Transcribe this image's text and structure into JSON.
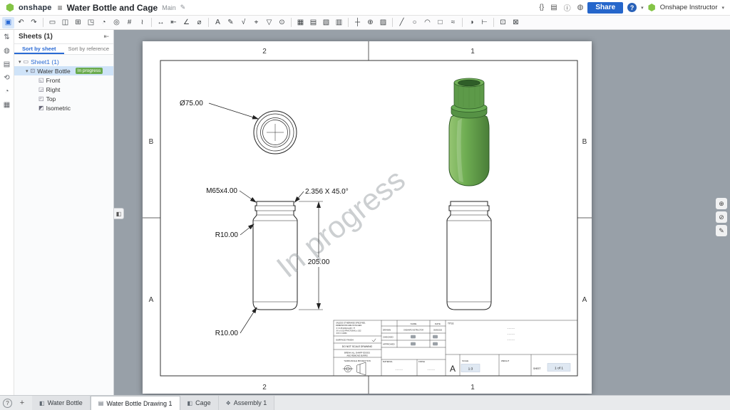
{
  "colors": {
    "accent_blue": "#2a6ad4",
    "share_blue": "#2566cb",
    "badge_green": "#6aab4e",
    "bottle_green": "#6fae53",
    "canvas_gray": "#98a0a8"
  },
  "header": {
    "logo_text": "onshape",
    "menu_icon": "≡",
    "title": "Water Bottle and Cage",
    "branch": "Main",
    "doc_icon": "✎",
    "right_icons": [
      {
        "n": "featurescript-icon",
        "g": "{}"
      },
      {
        "n": "spreadsheet-icon",
        "g": "▤"
      },
      {
        "n": "info-icon",
        "g": "ⓘ"
      },
      {
        "n": "app-store-icon",
        "g": "◍"
      }
    ],
    "share_label": "Share",
    "help_label": "?",
    "caret": "▾",
    "user_name": "Onshape Instructor"
  },
  "toolbar": {
    "items": [
      {
        "n": "select-tool-icon",
        "g": "▣",
        "act": true
      },
      {
        "n": "undo-icon",
        "g": "↶"
      },
      {
        "n": "redo-icon",
        "g": "↷"
      },
      {
        "sep": true,
        "n": "divider"
      },
      {
        "n": "insert-sheet-icon",
        "g": "▭"
      },
      {
        "n": "sheet-properties-icon",
        "g": "◫"
      },
      {
        "n": "insert-view-icon",
        "g": "⊞"
      },
      {
        "n": "projected-view-icon",
        "g": "◳"
      },
      {
        "n": "section-view-icon",
        "g": "◔"
      },
      {
        "n": "detail-view-icon",
        "g": "◎"
      },
      {
        "n": "crop-view-icon",
        "g": "#"
      },
      {
        "n": "break-view-icon",
        "g": "≀"
      },
      {
        "sep": true,
        "n": "divider"
      },
      {
        "n": "dimension-icon",
        "g": "↔"
      },
      {
        "n": "ordinate-dimension-icon",
        "g": "⇤"
      },
      {
        "n": "angle-dimension-icon",
        "g": "∠"
      },
      {
        "n": "diameter-dimension-icon",
        "g": "⌀"
      },
      {
        "sep": true,
        "n": "divider"
      },
      {
        "n": "note-icon",
        "g": "A"
      },
      {
        "n": "callout-icon",
        "g": "✎"
      },
      {
        "n": "surface-finish-icon",
        "g": "√"
      },
      {
        "n": "geometric-tolerance-icon",
        "g": "⌖"
      },
      {
        "n": "datum-icon",
        "g": "▽"
      },
      {
        "n": "balloon-icon",
        "g": "⊙"
      },
      {
        "sep": true,
        "n": "divider"
      },
      {
        "n": "table-icon",
        "g": "▦"
      },
      {
        "n": "hole-table-icon",
        "g": "▤"
      },
      {
        "n": "bom-table-icon",
        "g": "▧"
      },
      {
        "n": "revision-table-icon",
        "g": "▥"
      },
      {
        "sep": true,
        "n": "divider"
      },
      {
        "n": "centerline-icon",
        "g": "┼"
      },
      {
        "n": "center-mark-icon",
        "g": "⊕"
      },
      {
        "n": "hatch-icon",
        "g": "▨"
      },
      {
        "sep": true,
        "n": "divider"
      },
      {
        "n": "line-tool-icon",
        "g": "╱"
      },
      {
        "n": "circle-tool-icon",
        "g": "○"
      },
      {
        "n": "arc-tool-icon",
        "g": "◠"
      },
      {
        "n": "rectangle-tool-icon",
        "g": "□"
      },
      {
        "n": "spline-tool-icon",
        "g": "≈"
      },
      {
        "sep": true,
        "n": "divider"
      },
      {
        "n": "show-hide-icon",
        "g": "◑"
      },
      {
        "n": "measure-icon",
        "g": "⊢"
      },
      {
        "sep": true,
        "n": "divider"
      },
      {
        "n": "zoom-window-icon",
        "g": "⊡"
      },
      {
        "n": "zoom-fit-icon",
        "g": "⊠"
      }
    ]
  },
  "left_rail": {
    "items": [
      {
        "n": "follow-icon",
        "g": "⇅"
      },
      {
        "n": "comment-icon",
        "g": "◍"
      },
      {
        "n": "clipboard-icon",
        "g": "▤"
      },
      {
        "n": "versions-icon",
        "g": "⟲"
      },
      {
        "n": "history-icon",
        "g": "◔"
      },
      {
        "n": "properties-icon",
        "g": "▦"
      }
    ]
  },
  "sheets_panel": {
    "title": "Sheets (1)",
    "pin_icon": "⇤",
    "sort_tabs": [
      {
        "label": "Sort by sheet",
        "active": true
      },
      {
        "label": "Sort by reference"
      }
    ],
    "sheet_row": {
      "caret": "▾",
      "icon": "▭",
      "label": "Sheet1 (1)"
    },
    "drawing_row": {
      "caret": "▾",
      "icon": "⊡",
      "label": "Water Bottle",
      "badge": "In progress"
    },
    "views": [
      {
        "g": "◱",
        "label": "Front"
      },
      {
        "g": "◲",
        "label": "Right"
      },
      {
        "g": "◰",
        "label": "Top"
      },
      {
        "g": "◩",
        "label": "Isometric"
      }
    ]
  },
  "canvas": {
    "collapse_glyph": "◧",
    "side_tools": [
      {
        "n": "zoom-fit-icon",
        "g": "⊕"
      },
      {
        "n": "hide-annotations-icon",
        "g": "⊘"
      },
      {
        "n": "edit-appearance-icon",
        "g": "✎"
      }
    ]
  },
  "drawing": {
    "watermark": "In progress",
    "zones": {
      "top_left": "2",
      "top_right": "1",
      "bottom_left": "2",
      "bottom_right": "1",
      "left_top": "B",
      "left_bottom": "A",
      "right_top": "B",
      "right_bottom": "A"
    },
    "dims": {
      "diameter": "Ø75.00",
      "thread": "M65x4.00",
      "chamfer": "2.356 X 45.0°",
      "radius_top": "R10.00",
      "height": "205.00",
      "radius_bottom": "R10.00"
    },
    "title_block": {
      "spec_line1": "UNLESS OTHERWISE SPECIFIED,",
      "spec_line2": "DIMENSIONS ARE IN INCHES",
      "tol_line1": ".X ± 0.05    ANGULAR ± .5°",
      "tol_line2": ".XX ± 0.010   FRACTIONAL ± 1/32",
      "tol_line3": ".XXX ± 0.0050",
      "surface_finish": "SURFACE FINISH",
      "do_not_scale": "DO NOT SCALE DRAWING",
      "break_edges1": "BREAK ALL SHARP EDGES",
      "break_edges2": "AND REMOVE BURRS",
      "projection": "THIRD ANGLE PROJECTION",
      "name_header": "NAME",
      "date_header": "DATE",
      "drawn_label": "DRAWN",
      "drawn_name": "ONSHAPE INSTRUCTOR",
      "drawn_date": "05/08/2023",
      "checked_label": "CHECKED",
      "approved_label": "APPROVED",
      "title_label": "TITLE",
      "dash": "-----",
      "material_label": "MATERIAL",
      "finish_label": "FINISH",
      "size": "A",
      "scale_label": "SCALE",
      "scale_value": "1:3",
      "weight_label": "WEIGHT",
      "sheet_label": "SHEET",
      "sheet_value": "1 of 1"
    }
  },
  "tab_bar": {
    "help_icon": "?",
    "add_label": "+",
    "tabs": [
      {
        "g": "◧",
        "label": "Water Bottle"
      },
      {
        "g": "▤",
        "label": "Water Bottle Drawing 1",
        "active": true
      },
      {
        "g": "◧",
        "label": "Cage"
      },
      {
        "g": "❖",
        "label": "Assembly 1"
      }
    ]
  }
}
